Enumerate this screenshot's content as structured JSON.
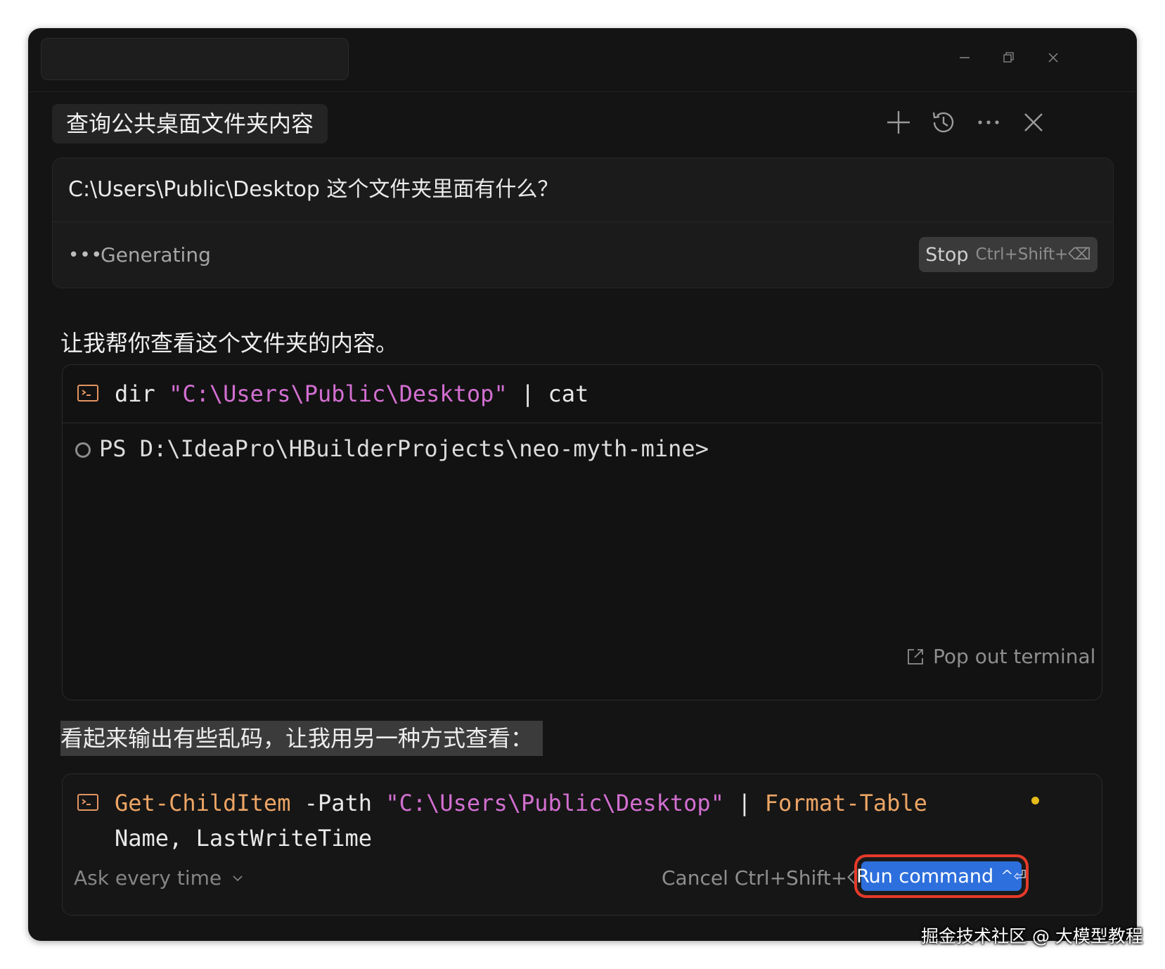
{
  "chat": {
    "title": "查询公共桌面文件夹内容",
    "header_icons": [
      "plus-icon",
      "history-icon",
      "more-icon",
      "close-icon"
    ]
  },
  "window_controls": [
    "minimize-icon",
    "restore-icon",
    "close-icon"
  ],
  "query": {
    "text": "C:\\Users\\Public\\Desktop 这个文件夹里面有什么？",
    "status": "Generating",
    "stop_label": "Stop",
    "stop_shortcut": "Ctrl+Shift+⌫"
  },
  "messages": {
    "first": "让我帮你查看这个文件夹的内容。",
    "second": "看起来输出有些乱码，让我用另一种方式查看："
  },
  "terminal1": {
    "cmd_name": "dir",
    "cmd_path": "\"C:\\Users\\Public\\Desktop\"",
    "cmd_pipe": "|",
    "cmd_tail": "cat",
    "prompt": "PS D:\\IdeaPro\\HBuilderProjects\\neo-myth-mine>",
    "popout_label": "Pop out terminal"
  },
  "terminal2": {
    "cmd_name": "Get-ChildItem",
    "cmd_flag": "-Path",
    "cmd_path": "\"C:\\Users\\Public\\Desktop\"",
    "cmd_pipe": "|",
    "cmd_format": "Format-Table",
    "cmd_line2": "Name, LastWriteTime",
    "ask_label": "Ask every time",
    "cancel_label": "Cancel Ctrl+Shift+⌫",
    "run_label": "Run command",
    "run_shortcut": "^⏎"
  },
  "colors": {
    "background": "#141414",
    "string": "#d36fd1",
    "command": "#eda565",
    "run_button": "#2d6fdc",
    "highlight_border": "#e53a2a",
    "pending_dot": "#e6bb1a"
  },
  "watermark": "掘金技术社区 @ 大模型教程"
}
